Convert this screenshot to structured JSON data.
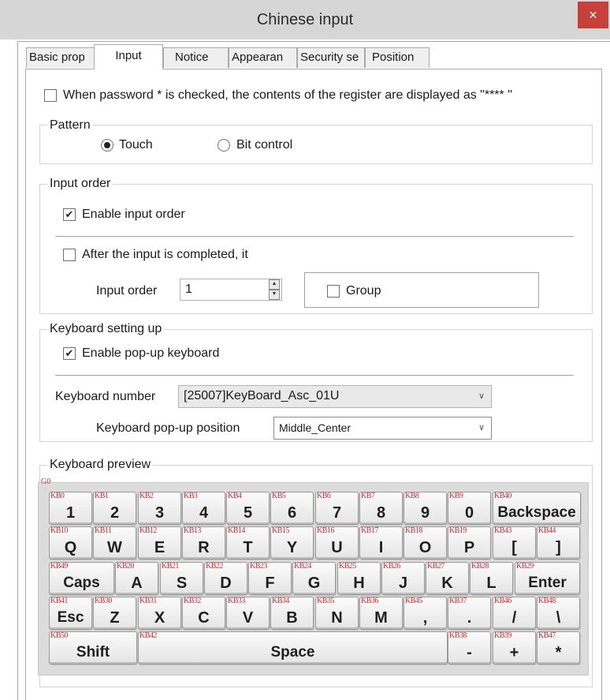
{
  "window": {
    "title": "Chinese input",
    "close_glyph": "×"
  },
  "tabs": [
    "Basic prop",
    "Input",
    "Notice",
    "Appearan",
    "Security se",
    "Position"
  ],
  "password": {
    "label": "When password * is checked, the contents of the register are displayed as \"****  \"",
    "checked": false
  },
  "pattern": {
    "legend": "Pattern",
    "options": [
      {
        "label": "Touch",
        "selected": true
      },
      {
        "label": "Bit control",
        "selected": false
      }
    ]
  },
  "input_order": {
    "legend": "Input order",
    "enable": {
      "label": "Enable input order",
      "checked": true
    },
    "after": {
      "label": "After the input is completed, it",
      "checked": false
    },
    "order_label": "Input order",
    "order_value": "1",
    "group": {
      "label": "Group",
      "checked": false
    }
  },
  "keyboard_setting": {
    "legend": "Keyboard setting up",
    "enable": {
      "label": "Enable pop-up keyboard",
      "checked": true
    },
    "number_label": "Keyboard number",
    "number_value": "[25007]KeyBoard_Asc_01U",
    "position_label": "Keyboard pop-up position",
    "position_value": "Middle_Center"
  },
  "preview": {
    "legend": "Keyboard preview",
    "group_id": "G0",
    "rows": [
      [
        {
          "id": "KB0",
          "cap": "1"
        },
        {
          "id": "KB1",
          "cap": "2"
        },
        {
          "id": "KB2",
          "cap": "3"
        },
        {
          "id": "KB3",
          "cap": "4"
        },
        {
          "id": "KB4",
          "cap": "5"
        },
        {
          "id": "KB5",
          "cap": "6"
        },
        {
          "id": "KB6",
          "cap": "7"
        },
        {
          "id": "KB7",
          "cap": "8"
        },
        {
          "id": "KB8",
          "cap": "9"
        },
        {
          "id": "KB9",
          "cap": "0"
        },
        {
          "id": "KB40",
          "cap": "Backspace"
        }
      ],
      [
        {
          "id": "KB10",
          "cap": "Q"
        },
        {
          "id": "KB11",
          "cap": "W"
        },
        {
          "id": "KB12",
          "cap": "E"
        },
        {
          "id": "KB13",
          "cap": "R"
        },
        {
          "id": "KB14",
          "cap": "T"
        },
        {
          "id": "KB15",
          "cap": "Y"
        },
        {
          "id": "KB16",
          "cap": "U"
        },
        {
          "id": "KB17",
          "cap": "I"
        },
        {
          "id": "KB18",
          "cap": "O"
        },
        {
          "id": "KB19",
          "cap": "P"
        },
        {
          "id": "KB43",
          "cap": "["
        },
        {
          "id": "KB44",
          "cap": "]"
        }
      ],
      [
        {
          "id": "KB49",
          "cap": "Caps"
        },
        {
          "id": "KB20",
          "cap": "A"
        },
        {
          "id": "KB21",
          "cap": "S"
        },
        {
          "id": "KB22",
          "cap": "D"
        },
        {
          "id": "KB23",
          "cap": "F"
        },
        {
          "id": "KB24",
          "cap": "G"
        },
        {
          "id": "KB25",
          "cap": "H"
        },
        {
          "id": "KB26",
          "cap": "J"
        },
        {
          "id": "KB27",
          "cap": "K"
        },
        {
          "id": "KB28",
          "cap": "L"
        },
        {
          "id": "KB29",
          "cap": "Enter"
        }
      ],
      [
        {
          "id": "KB41",
          "cap": "Esc"
        },
        {
          "id": "KB30",
          "cap": "Z"
        },
        {
          "id": "KB31",
          "cap": "X"
        },
        {
          "id": "KB32",
          "cap": "C"
        },
        {
          "id": "KB33",
          "cap": "V"
        },
        {
          "id": "KB34",
          "cap": "B"
        },
        {
          "id": "KB35",
          "cap": "N"
        },
        {
          "id": "KB36",
          "cap": "M"
        },
        {
          "id": "KB45",
          "cap": ","
        },
        {
          "id": "KB37",
          "cap": "."
        },
        {
          "id": "KB46",
          "cap": "/"
        },
        {
          "id": "KB48",
          "cap": "\\"
        }
      ],
      [
        {
          "id": "KB50",
          "cap": "Shift"
        },
        {
          "id": "KB42",
          "cap": "Space"
        },
        {
          "id": "KB38",
          "cap": "-"
        },
        {
          "id": "KB39",
          "cap": "+"
        },
        {
          "id": "KB47",
          "cap": "*"
        }
      ]
    ]
  }
}
